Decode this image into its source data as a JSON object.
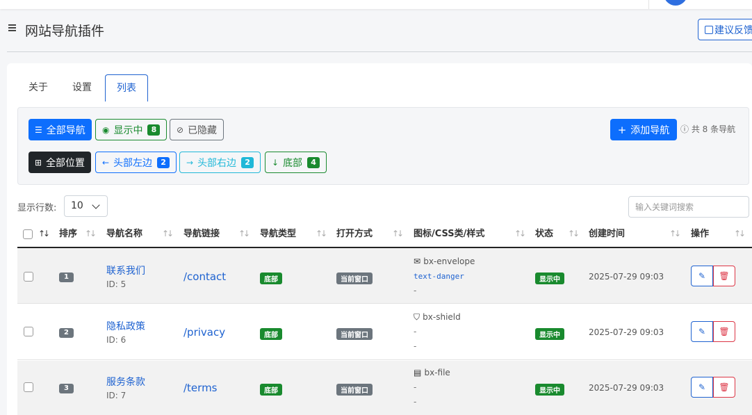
{
  "header": {
    "title": "网站导航插件",
    "feedback_label": "建议反馈"
  },
  "tabs": [
    {
      "label": "关于"
    },
    {
      "label": "设置"
    },
    {
      "label": "列表"
    }
  ],
  "filters": {
    "visibility": [
      {
        "label": "全部导航",
        "icon": "list-icon"
      },
      {
        "label": "显示中",
        "count": "8",
        "icon": "eye-icon"
      },
      {
        "label": "已隐藏",
        "icon": "eye-slash-icon"
      }
    ],
    "positions": [
      {
        "label": "全部位置",
        "icon": "grid-icon"
      },
      {
        "label": "头部左边",
        "count": "2",
        "icon": "arrow-left-icon"
      },
      {
        "label": "头部右边",
        "count": "2",
        "icon": "arrow-right-icon"
      },
      {
        "label": "底部",
        "count": "4",
        "icon": "arrow-down-icon"
      }
    ],
    "add_label": "添加导航",
    "total_text": "共 8 条导航"
  },
  "table_controls": {
    "rows_label": "显示行数:",
    "rows_value": "10",
    "search_placeholder": "输入关键词搜索"
  },
  "table": {
    "columns": [
      "排序",
      "导航名称",
      "导航链接",
      "导航类型",
      "打开方式",
      "图标/CSS类/样式",
      "状态",
      "创建时间",
      "操作"
    ],
    "rows": [
      {
        "order": "1",
        "name": "联系我们",
        "id": "ID: 5",
        "url": "/contact",
        "type": "底部",
        "open": "当前窗口",
        "icon": "bx-envelope",
        "icon_glyph": "envelope-icon",
        "css": "text-danger",
        "style": "-",
        "status": "显示中",
        "created": "2025-07-29 09:03"
      },
      {
        "order": "2",
        "name": "隐私政策",
        "id": "ID: 6",
        "url": "/privacy",
        "type": "底部",
        "open": "当前窗口",
        "icon": "bx-shield",
        "icon_glyph": "shield-icon",
        "css": "-",
        "style": "-",
        "status": "显示中",
        "created": "2025-07-29 09:03"
      },
      {
        "order": "3",
        "name": "服务条款",
        "id": "ID: 7",
        "url": "/terms",
        "type": "底部",
        "open": "当前窗口",
        "icon": "bx-file",
        "icon_glyph": "file-icon",
        "css": "-",
        "style": "-",
        "status": "显示中",
        "created": "2025-07-29 09:03"
      }
    ]
  },
  "colors": {
    "primary": "#0d6efd",
    "link": "#1e62d0",
    "success": "#198a2e",
    "info": "#20b8d8",
    "danger": "#dc3545",
    "dark": "#212529",
    "secondary": "#6c757d"
  }
}
